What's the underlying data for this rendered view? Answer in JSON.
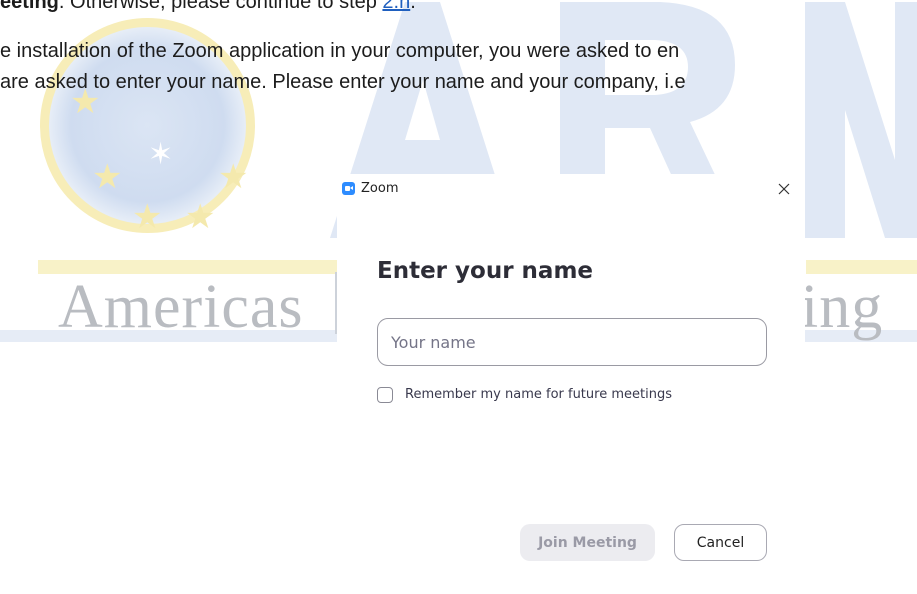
{
  "document": {
    "line1_bold": "eeting",
    "line1_text": ". Otherwise, please continue to step ",
    "line1_link": "2.h",
    "line1_end": ".",
    "line2": "e installation of the Zoom application in your computer, you were asked to en",
    "line3": " are asked to enter your name. Please enter your name and your company, i.e"
  },
  "watermark": {
    "letters": "ARN",
    "word_left": "Americas",
    "word_right": "king",
    "colors": {
      "gold": "#f4e9ad",
      "blue": "#cfdcf0",
      "gray": "#b9bcc1"
    }
  },
  "dialog": {
    "window_title": "Zoom",
    "app_icon": "zoom-camera-icon",
    "close_icon": "close-icon",
    "heading": "Enter your name",
    "name_input": {
      "placeholder": "Your name",
      "value": ""
    },
    "remember": {
      "label": "Remember my name for future meetings",
      "checked": false
    },
    "join_button": {
      "label": "Join Meeting",
      "enabled": false
    },
    "cancel_button": {
      "label": "Cancel"
    },
    "colors": {
      "accent": "#2d8cff",
      "heading": "#2d2d37",
      "disabled_bg": "#ececf0",
      "disabled_text": "#9a9aa6"
    }
  }
}
